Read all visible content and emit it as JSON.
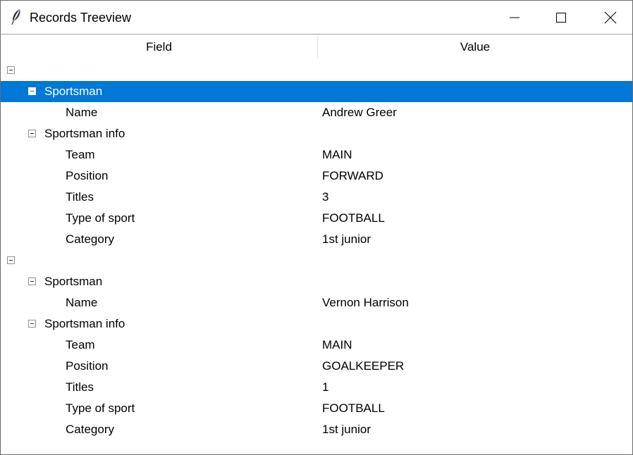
{
  "window": {
    "title": "Records Treeview",
    "icon": "feather-icon",
    "controls": {
      "minimize": "minimize-icon",
      "maximize": "maximize-icon",
      "close": "close-icon"
    }
  },
  "columns": {
    "field": "Field",
    "value": "Value"
  },
  "colors": {
    "selection": "#0078d7"
  },
  "records": [
    {
      "sportsman_label": "Sportsman",
      "sportsman_selected": true,
      "name_label": "Name",
      "name_value": "Andrew Greer",
      "info_label": "Sportsman info",
      "info": [
        {
          "label": "Team",
          "value": "MAIN"
        },
        {
          "label": "Position",
          "value": "FORWARD"
        },
        {
          "label": "Titles",
          "value": "3"
        },
        {
          "label": "Type of sport",
          "value": "FOOTBALL"
        },
        {
          "label": "Category",
          "value": "1st junior"
        }
      ]
    },
    {
      "sportsman_label": "Sportsman",
      "sportsman_selected": false,
      "name_label": "Name",
      "name_value": "Vernon Harrison",
      "info_label": "Sportsman info",
      "info": [
        {
          "label": "Team",
          "value": "MAIN"
        },
        {
          "label": "Position",
          "value": "GOALKEEPER"
        },
        {
          "label": "Titles",
          "value": "1"
        },
        {
          "label": "Type of sport",
          "value": "FOOTBALL"
        },
        {
          "label": "Category",
          "value": "1st junior"
        }
      ]
    }
  ]
}
